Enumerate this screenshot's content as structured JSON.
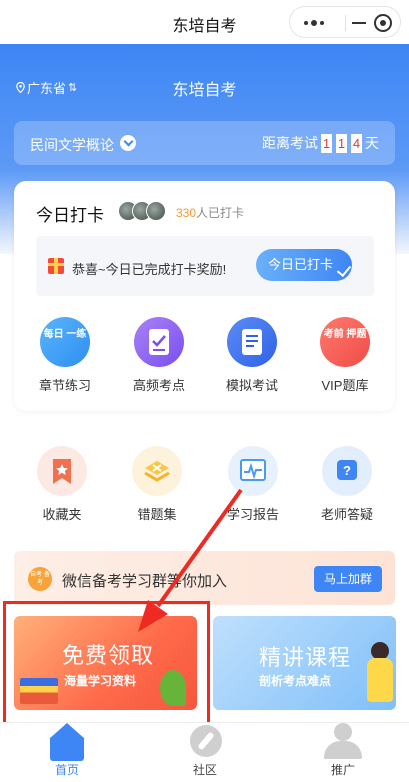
{
  "nav": {
    "title": "东培自考"
  },
  "header": {
    "region": "广东省",
    "region_switch_glyph": "⇅",
    "app_name": "东培自考",
    "subject": "民间文学概论",
    "countdown_prefix": "距离考试",
    "countdown_digits": [
      "1",
      "1",
      "4"
    ],
    "countdown_suffix": "天"
  },
  "checkin": {
    "title": "今日打卡",
    "count": "330",
    "count_suffix": "人已打卡",
    "reward_text": "恭喜~今日已完成打卡奖励!",
    "button": "今日已打卡"
  },
  "features": [
    {
      "label": "章节练习",
      "icon_text": "每日 一练",
      "icon": "daily-practice-icon"
    },
    {
      "label": "高频考点",
      "icon": "checklist-icon"
    },
    {
      "label": "模拟考试",
      "icon": "exam-paper-icon"
    },
    {
      "label": "VIP题库",
      "icon_text": "考前 押题",
      "icon": "vip-bank-icon"
    }
  ],
  "tools": [
    {
      "label": "收藏夹",
      "icon": "bookmark-star-icon"
    },
    {
      "label": "错题集",
      "icon": "wrong-answers-icon"
    },
    {
      "label": "学习报告",
      "icon": "report-chart-icon"
    },
    {
      "label": "老师答疑",
      "icon": "question-chat-icon"
    }
  ],
  "wechat": {
    "logo_text": "自考 备考",
    "text": "微信备考学习群等你加入",
    "button": "马上加群"
  },
  "promos": [
    {
      "title": "免费领取",
      "subtitle": "海量学习资料"
    },
    {
      "title": "精讲课程",
      "subtitle": "剖析考点难点"
    }
  ],
  "tabs": [
    {
      "label": "首页",
      "icon": "home-icon"
    },
    {
      "label": "社区",
      "icon": "community-icon"
    },
    {
      "label": "推广",
      "icon": "user-icon"
    }
  ],
  "colors": {
    "primary": "#3e86f5",
    "accent_orange": "#f29a2e",
    "annotation_red": "#ee2a22"
  }
}
